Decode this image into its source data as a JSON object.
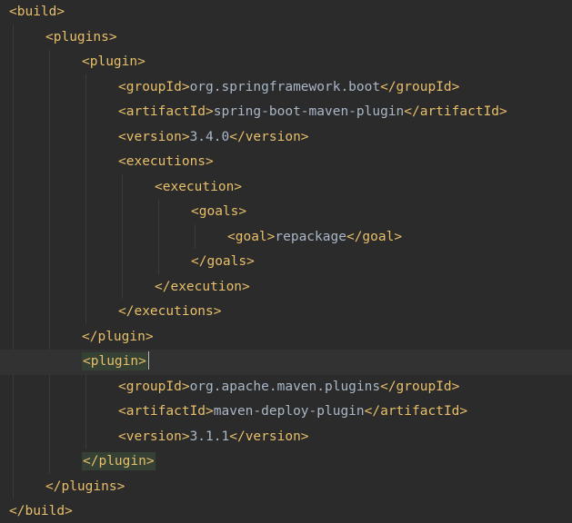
{
  "editor": {
    "language": "xml",
    "colors": {
      "background": "#2b2b2b",
      "tag": "#e8bf6a",
      "text": "#a9b7c6",
      "current_line": "#323232",
      "matched_tag_highlight": "#344134"
    },
    "lines": [
      {
        "tag_open": "<build>"
      },
      {
        "tag_open": "<plugins>"
      },
      {
        "tag_open": "<plugin>"
      },
      {
        "tag_open": "<groupId>",
        "text": "org.springframework.boot",
        "tag_close": "</groupId>"
      },
      {
        "tag_open": "<artifactId>",
        "text": "spring-boot-maven-plugin",
        "tag_close": "</artifactId>"
      },
      {
        "tag_open": "<version>",
        "text": "3.4.0",
        "tag_close": "</version>"
      },
      {
        "tag_open": "<executions>"
      },
      {
        "tag_open": "<execution>"
      },
      {
        "tag_open": "<goals>"
      },
      {
        "tag_open": "<goal>",
        "text": "repackage",
        "tag_close": "</goal>"
      },
      {
        "tag_open": "</goals>"
      },
      {
        "tag_open": "</execution>"
      },
      {
        "tag_open": "</executions>"
      },
      {
        "tag_open": "</plugin>"
      },
      {
        "tag_open": "<plugin>"
      },
      {
        "tag_open": "<groupId>",
        "text": "org.apache.maven.plugins",
        "tag_close": "</groupId>"
      },
      {
        "tag_open": "<artifactId>",
        "text": "maven-deploy-plugin",
        "tag_close": "</artifactId>"
      },
      {
        "tag_open": "<version>",
        "text": "3.1.1",
        "tag_close": "</version>"
      },
      {
        "tag_open": "</plugin>"
      },
      {
        "tag_open": "</plugins>"
      },
      {
        "tag_open": "</build>"
      }
    ]
  }
}
